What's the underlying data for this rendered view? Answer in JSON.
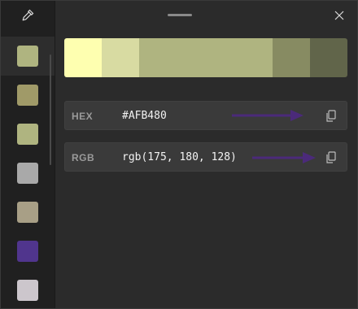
{
  "app": {
    "icons": {
      "picker": "eyedropper-icon",
      "close": "close-icon",
      "copy": "copy-icon",
      "arrow": "arrow-right-icon"
    }
  },
  "history": [
    {
      "color": "#AFB480",
      "selected": true
    },
    {
      "color": "#A09A68"
    },
    {
      "color": "#AFB480"
    },
    {
      "color": "#A9A9A9"
    },
    {
      "color": "#A89F86"
    },
    {
      "color": "#50358D"
    },
    {
      "color": "#CCC6CC"
    }
  ],
  "shades": [
    "#FEFFB0",
    "#D8DBA2",
    "#AFB480",
    "#878B62",
    "#61654A"
  ],
  "fields": {
    "hex": {
      "label": "HEX",
      "value": "#AFB480"
    },
    "rgb": {
      "label": "RGB",
      "value": "rgb(175, 180, 128)"
    }
  },
  "annotation_color": "#4B2A7A"
}
